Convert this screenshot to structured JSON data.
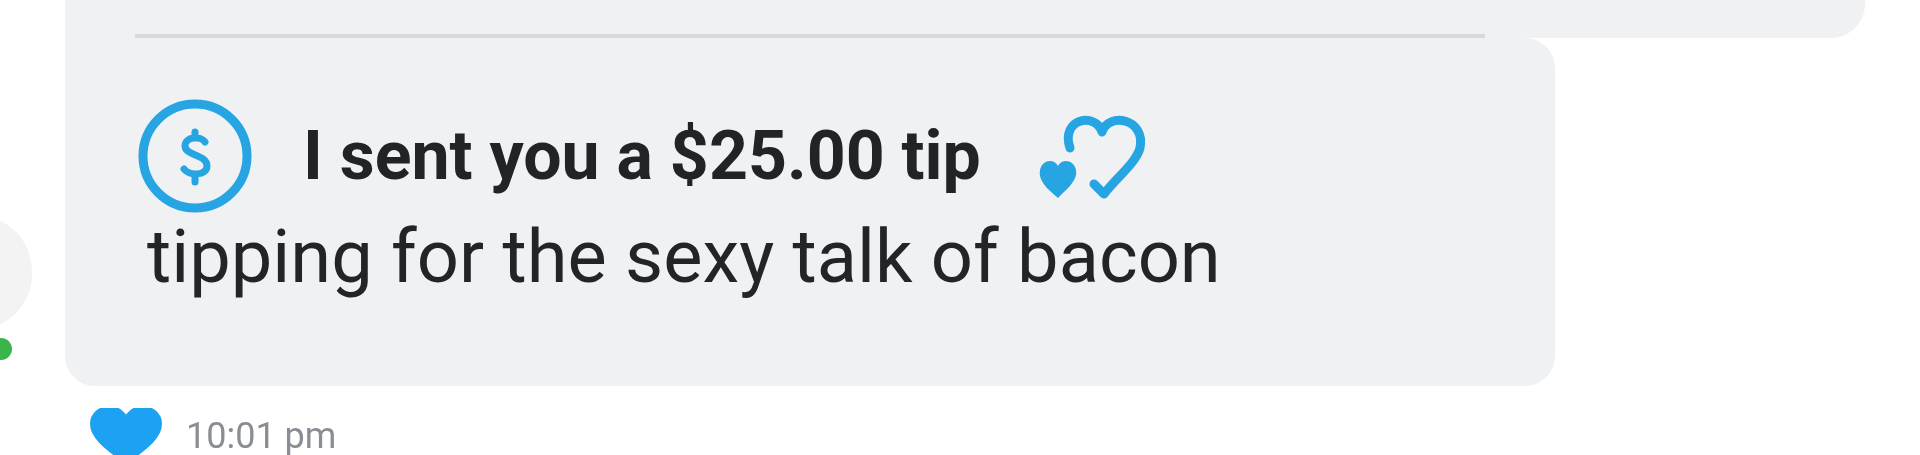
{
  "sender": {
    "online": true
  },
  "message": {
    "tip_text": "I sent you a $25.00 tip",
    "text": "tipping for the sexy talk of bacon",
    "liked": true,
    "time": "10:01 pm"
  }
}
